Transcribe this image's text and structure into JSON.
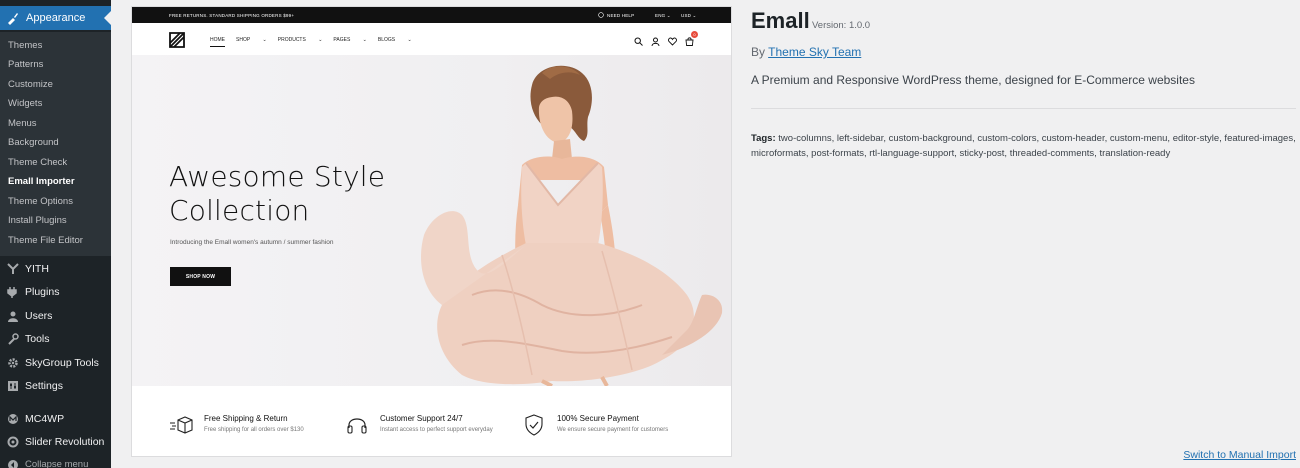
{
  "sidebar": {
    "current": "Appearance",
    "submenu": [
      "Themes",
      "Patterns",
      "Customize",
      "Widgets",
      "Menus",
      "Background",
      "Theme Check",
      "Emall Importer",
      "Theme Options",
      "Install Plugins",
      "Theme File Editor"
    ],
    "current_sub": "Emall Importer",
    "items": [
      {
        "label": "YITH",
        "icon": "yith-icon"
      },
      {
        "label": "Plugins",
        "icon": "plugin-icon"
      },
      {
        "label": "Users",
        "icon": "users-icon"
      },
      {
        "label": "Tools",
        "icon": "wrench-icon"
      },
      {
        "label": "SkyGroup Tools",
        "icon": "gear-icon"
      },
      {
        "label": "Settings",
        "icon": "settings-icon"
      },
      {
        "label": "MC4WP",
        "icon": "mc4wp-icon"
      },
      {
        "label": "Slider Revolution",
        "icon": "revolution-icon"
      }
    ],
    "collapse": "Collapse menu",
    "colors": {
      "bg": "#1d2327",
      "submenu_bg": "#2c3338",
      "accent": "#2271b1"
    }
  },
  "screenshot": {
    "topbar": {
      "promo": "FREE RETURNS. STANDARD SHIPPING ORDERS $99+",
      "help": "NEED HELP",
      "lang": "ENG",
      "currency": "USD"
    },
    "nav": [
      "HOME",
      "SHOP",
      "PRODUCTS",
      "PAGES",
      "BLOGS"
    ],
    "cart_count": "0",
    "hero": {
      "title_line1": "Awesome Style",
      "title_line2": "Collection",
      "subtitle": "Introducing the Emall women's autumn / summer fashion",
      "button": "SHOP NOW"
    },
    "features": [
      {
        "title": "Free Shipping & Return",
        "desc": "Free shipping for all orders over $130",
        "icon": "shipping-box-icon"
      },
      {
        "title": "Customer Support 24/7",
        "desc": "Instant access to perfect support everyday",
        "icon": "headphones-icon"
      },
      {
        "title": "100% Secure Payment",
        "desc": "We ensure secure payment for customers",
        "icon": "shield-check-icon"
      }
    ]
  },
  "theme": {
    "name": "Emall",
    "version": "Version: 1.0.0",
    "author_prefix": "By",
    "author": "Theme Sky Team",
    "description": "A Premium and Responsive WordPress theme, designed for E-Commerce websites",
    "tags_label": "Tags:",
    "tags": "two-columns, left-sidebar, custom-background, custom-colors, custom-header, custom-menu, editor-style, featured-images, microformats, post-formats, rtl-language-support, sticky-post, threaded-comments, translation-ready"
  },
  "manual_import": "Switch to Manual Import"
}
